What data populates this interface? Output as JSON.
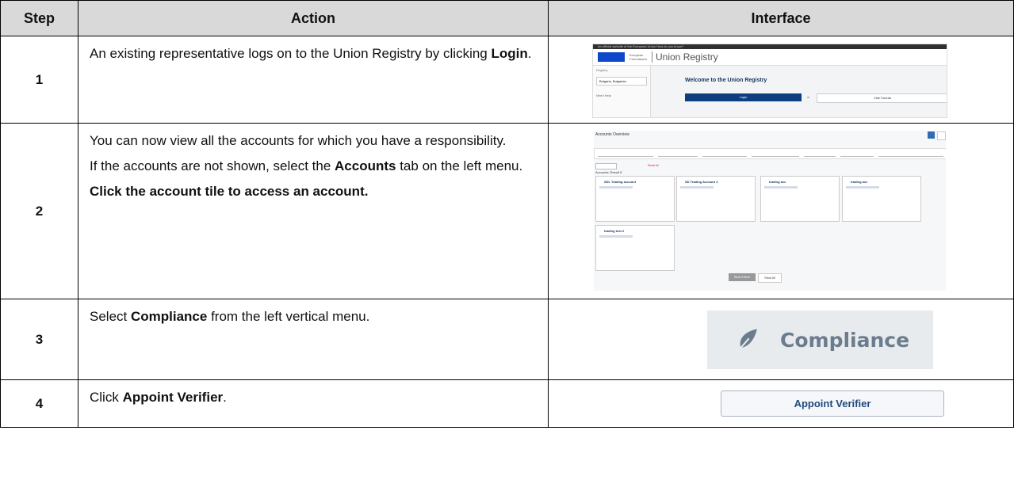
{
  "table": {
    "headers": {
      "step": "Step",
      "action": "Action",
      "interface": "Interface"
    },
    "rows": [
      {
        "step": "1",
        "action": [
          {
            "t": "An existing representative logs on to the Union Registry by clicking ",
            "b": "Login",
            "t2": "."
          }
        ]
      },
      {
        "step": "2",
        "action": [
          {
            "t": "You can now view all the accounts for which you have a responsibility."
          },
          {
            "t": "If the accounts are not shown, select the ",
            "b": "Accounts",
            "t2": " tab on the left menu."
          },
          {
            "b": "Click the account tile to access an account."
          }
        ]
      },
      {
        "step": "3",
        "action": [
          {
            "t": "Select ",
            "b": "Compliance",
            "t2": " from the left vertical menu."
          }
        ]
      },
      {
        "step": "4",
        "action": [
          {
            "t": "Click ",
            "b": "Appoint Verifier",
            "t2": "."
          }
        ]
      }
    ]
  },
  "screenshot1": {
    "top_banner": "An official website of the European Union   How do you know?",
    "ec_text": "European Commission",
    "registry_title": "Union Registry",
    "registry_label": "Registry",
    "country": "Bulgaria, Bulgarian",
    "need_help": "Need Help",
    "welcome": "Welcome to the Union Registry",
    "login_button": "Login",
    "or": "or",
    "visit_button": "Visit Tutorial"
  },
  "screenshot2": {
    "title": "Accounts Overview",
    "reset": "Reset All",
    "accounts_label": "Accounts: Result 5",
    "tiles": [
      {
        "name": "SDL Trading account"
      },
      {
        "name": "SD Trading Account 2"
      },
      {
        "name": "trading acc"
      },
      {
        "name": "trading acc"
      },
      {
        "name": "trading test 2"
      }
    ],
    "show_more": "Show 5 More",
    "show_all": "Show All"
  },
  "screenshot3": {
    "label": "Compliance",
    "icon": "compliance-icon"
  },
  "screenshot4": {
    "button": "Appoint Verifier"
  }
}
